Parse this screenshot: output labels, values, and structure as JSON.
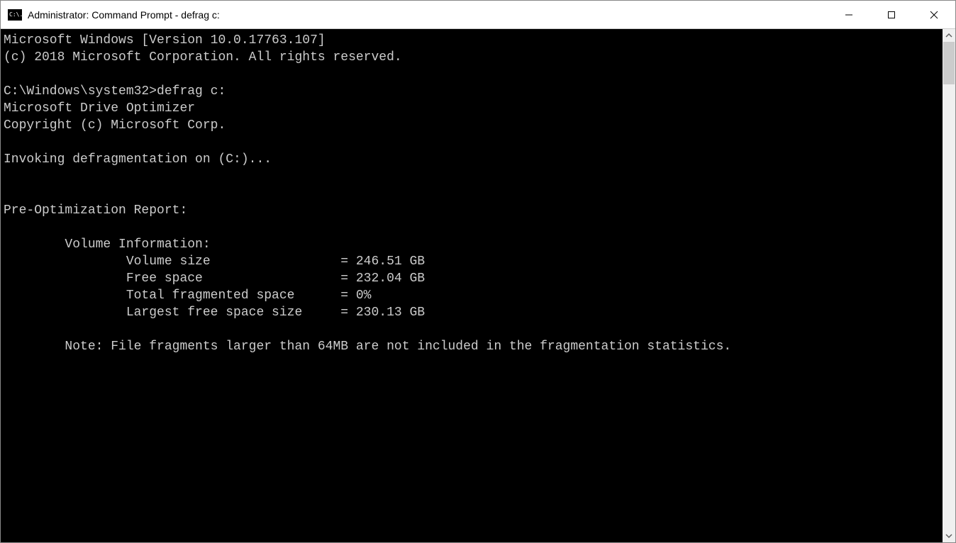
{
  "window": {
    "title": "Administrator: Command Prompt - defrag  c:",
    "icon_text": "C:\\."
  },
  "terminal": {
    "lines": {
      "l0": "Microsoft Windows [Version 10.0.17763.107]",
      "l1": "(c) 2018 Microsoft Corporation. All rights reserved.",
      "l2": "",
      "l3": "C:\\Windows\\system32>defrag c:",
      "l4": "Microsoft Drive Optimizer",
      "l5": "Copyright (c) Microsoft Corp.",
      "l6": "",
      "l7": "Invoking defragmentation on (C:)...",
      "l8": "",
      "l9": "",
      "l10": "Pre-Optimization Report:",
      "l11": "",
      "l12": "        Volume Information:",
      "l13": "                Volume size                 = 246.51 GB",
      "l14": "                Free space                  = 232.04 GB",
      "l15": "                Total fragmented space      = 0%",
      "l16": "                Largest free space size     = 230.13 GB",
      "l17": "",
      "l18": "        Note: File fragments larger than 64MB are not included in the fragmentation statistics.",
      "l19": ""
    }
  }
}
